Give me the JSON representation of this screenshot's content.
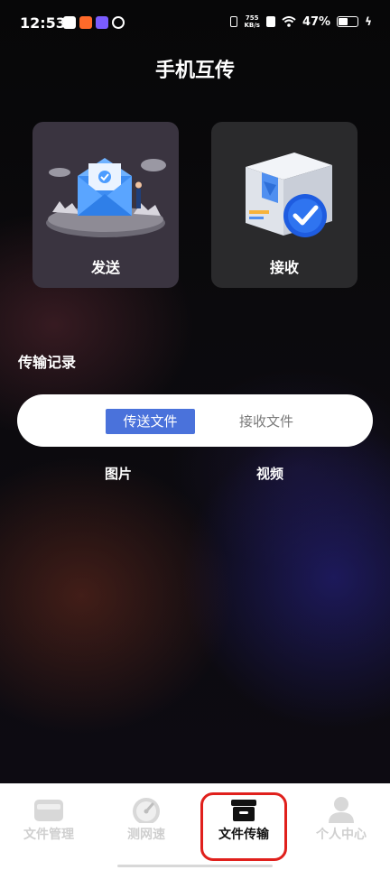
{
  "status_bar": {
    "time": "12:53",
    "net_speed_value": "755",
    "net_speed_unit": "KB/s",
    "battery": "47%",
    "battery_level": 0.47
  },
  "header": {
    "title": "手机互传"
  },
  "actions": {
    "send_label": "发送",
    "receive_label": "接收"
  },
  "records": {
    "title": "传输记录",
    "tabs": [
      {
        "label": "传送文件",
        "active": true
      },
      {
        "label": "接收文件",
        "active": false
      }
    ],
    "filters": [
      "图片",
      "视频"
    ]
  },
  "bottom_nav": {
    "items": [
      {
        "label": "文件管理",
        "icon": "folder-icon",
        "active": false
      },
      {
        "label": "测网速",
        "icon": "speedometer-icon",
        "active": false
      },
      {
        "label": "文件传输",
        "icon": "archive-box-icon",
        "active": true
      },
      {
        "label": "个人中心",
        "icon": "person-icon",
        "active": false
      }
    ]
  },
  "colors": {
    "accent": "#4a72db",
    "highlight": "#e0201c"
  }
}
